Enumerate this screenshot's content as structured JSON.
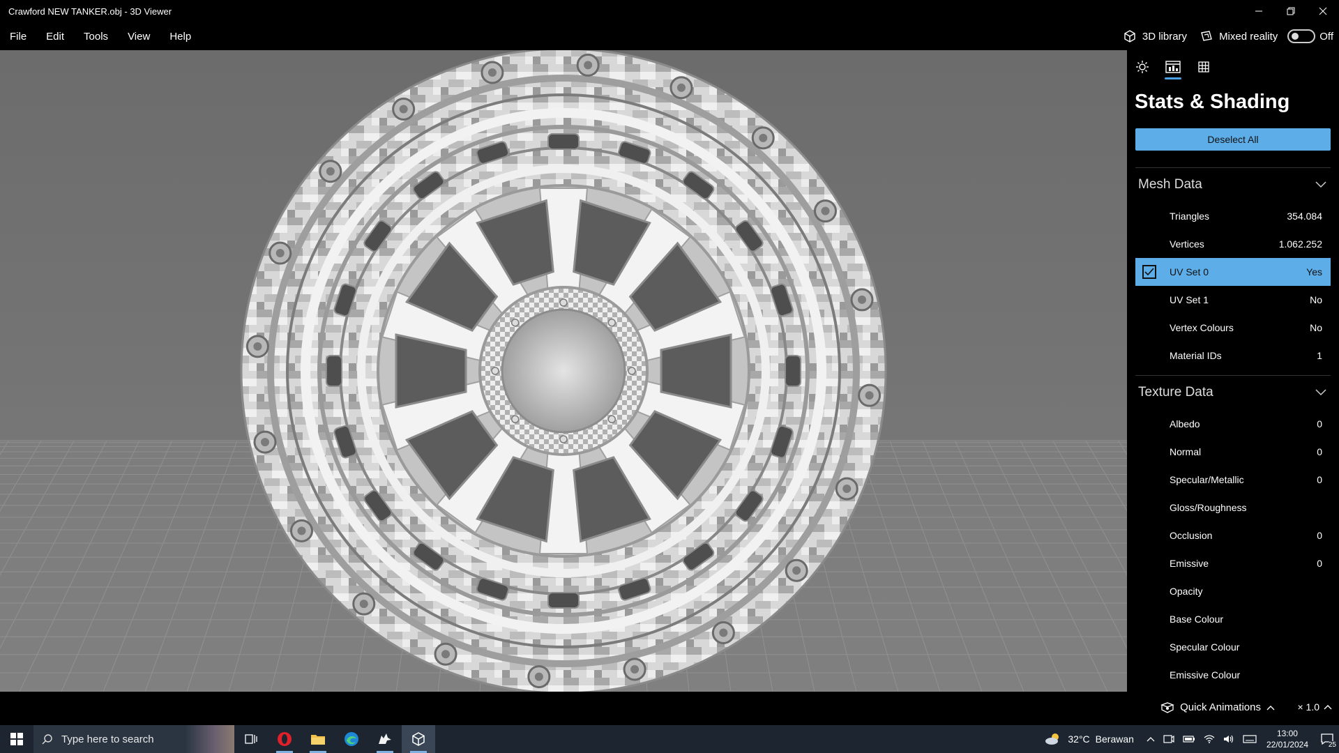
{
  "window": {
    "title": "Crawford NEW TANKER.obj - 3D Viewer"
  },
  "menubar": {
    "items": [
      "File",
      "Edit",
      "Tools",
      "View",
      "Help"
    ],
    "library_label": "3D library",
    "mixed_reality_label": "Mixed reality",
    "mixed_reality_state": "Off"
  },
  "panel": {
    "title": "Stats & Shading",
    "deselect_label": "Deselect All",
    "mesh_section": "Mesh Data",
    "mesh_rows": [
      {
        "label": "Triangles",
        "value": "354.084"
      },
      {
        "label": "Vertices",
        "value": "1.062.252"
      },
      {
        "label": "UV Set 0",
        "value": "Yes"
      },
      {
        "label": "UV Set 1",
        "value": "No"
      },
      {
        "label": "Vertex Colours",
        "value": "No"
      },
      {
        "label": "Material IDs",
        "value": "1"
      }
    ],
    "texture_section": "Texture Data",
    "texture_rows": [
      {
        "label": "Albedo",
        "value": "0"
      },
      {
        "label": "Normal",
        "value": "0"
      },
      {
        "label": "Specular/Metallic",
        "value": "0"
      },
      {
        "label": "Gloss/Roughness",
        "value": ""
      },
      {
        "label": "Occlusion",
        "value": "0"
      },
      {
        "label": "Emissive",
        "value": "0"
      },
      {
        "label": "Opacity",
        "value": ""
      },
      {
        "label": "Base Colour",
        "value": ""
      },
      {
        "label": "Specular Colour",
        "value": ""
      },
      {
        "label": "Emissive Colour",
        "value": ""
      }
    ],
    "accent_color": "#5dade8"
  },
  "bottombar": {
    "quick_animations_label": "Quick Animations",
    "speed_label": "× 1.0"
  },
  "taskbar": {
    "search_placeholder": "Type here to search",
    "weather_temp": "32°C",
    "weather_desc": "Berawan",
    "time": "13:00",
    "date": "22/01/2024",
    "notification_count": "25"
  }
}
